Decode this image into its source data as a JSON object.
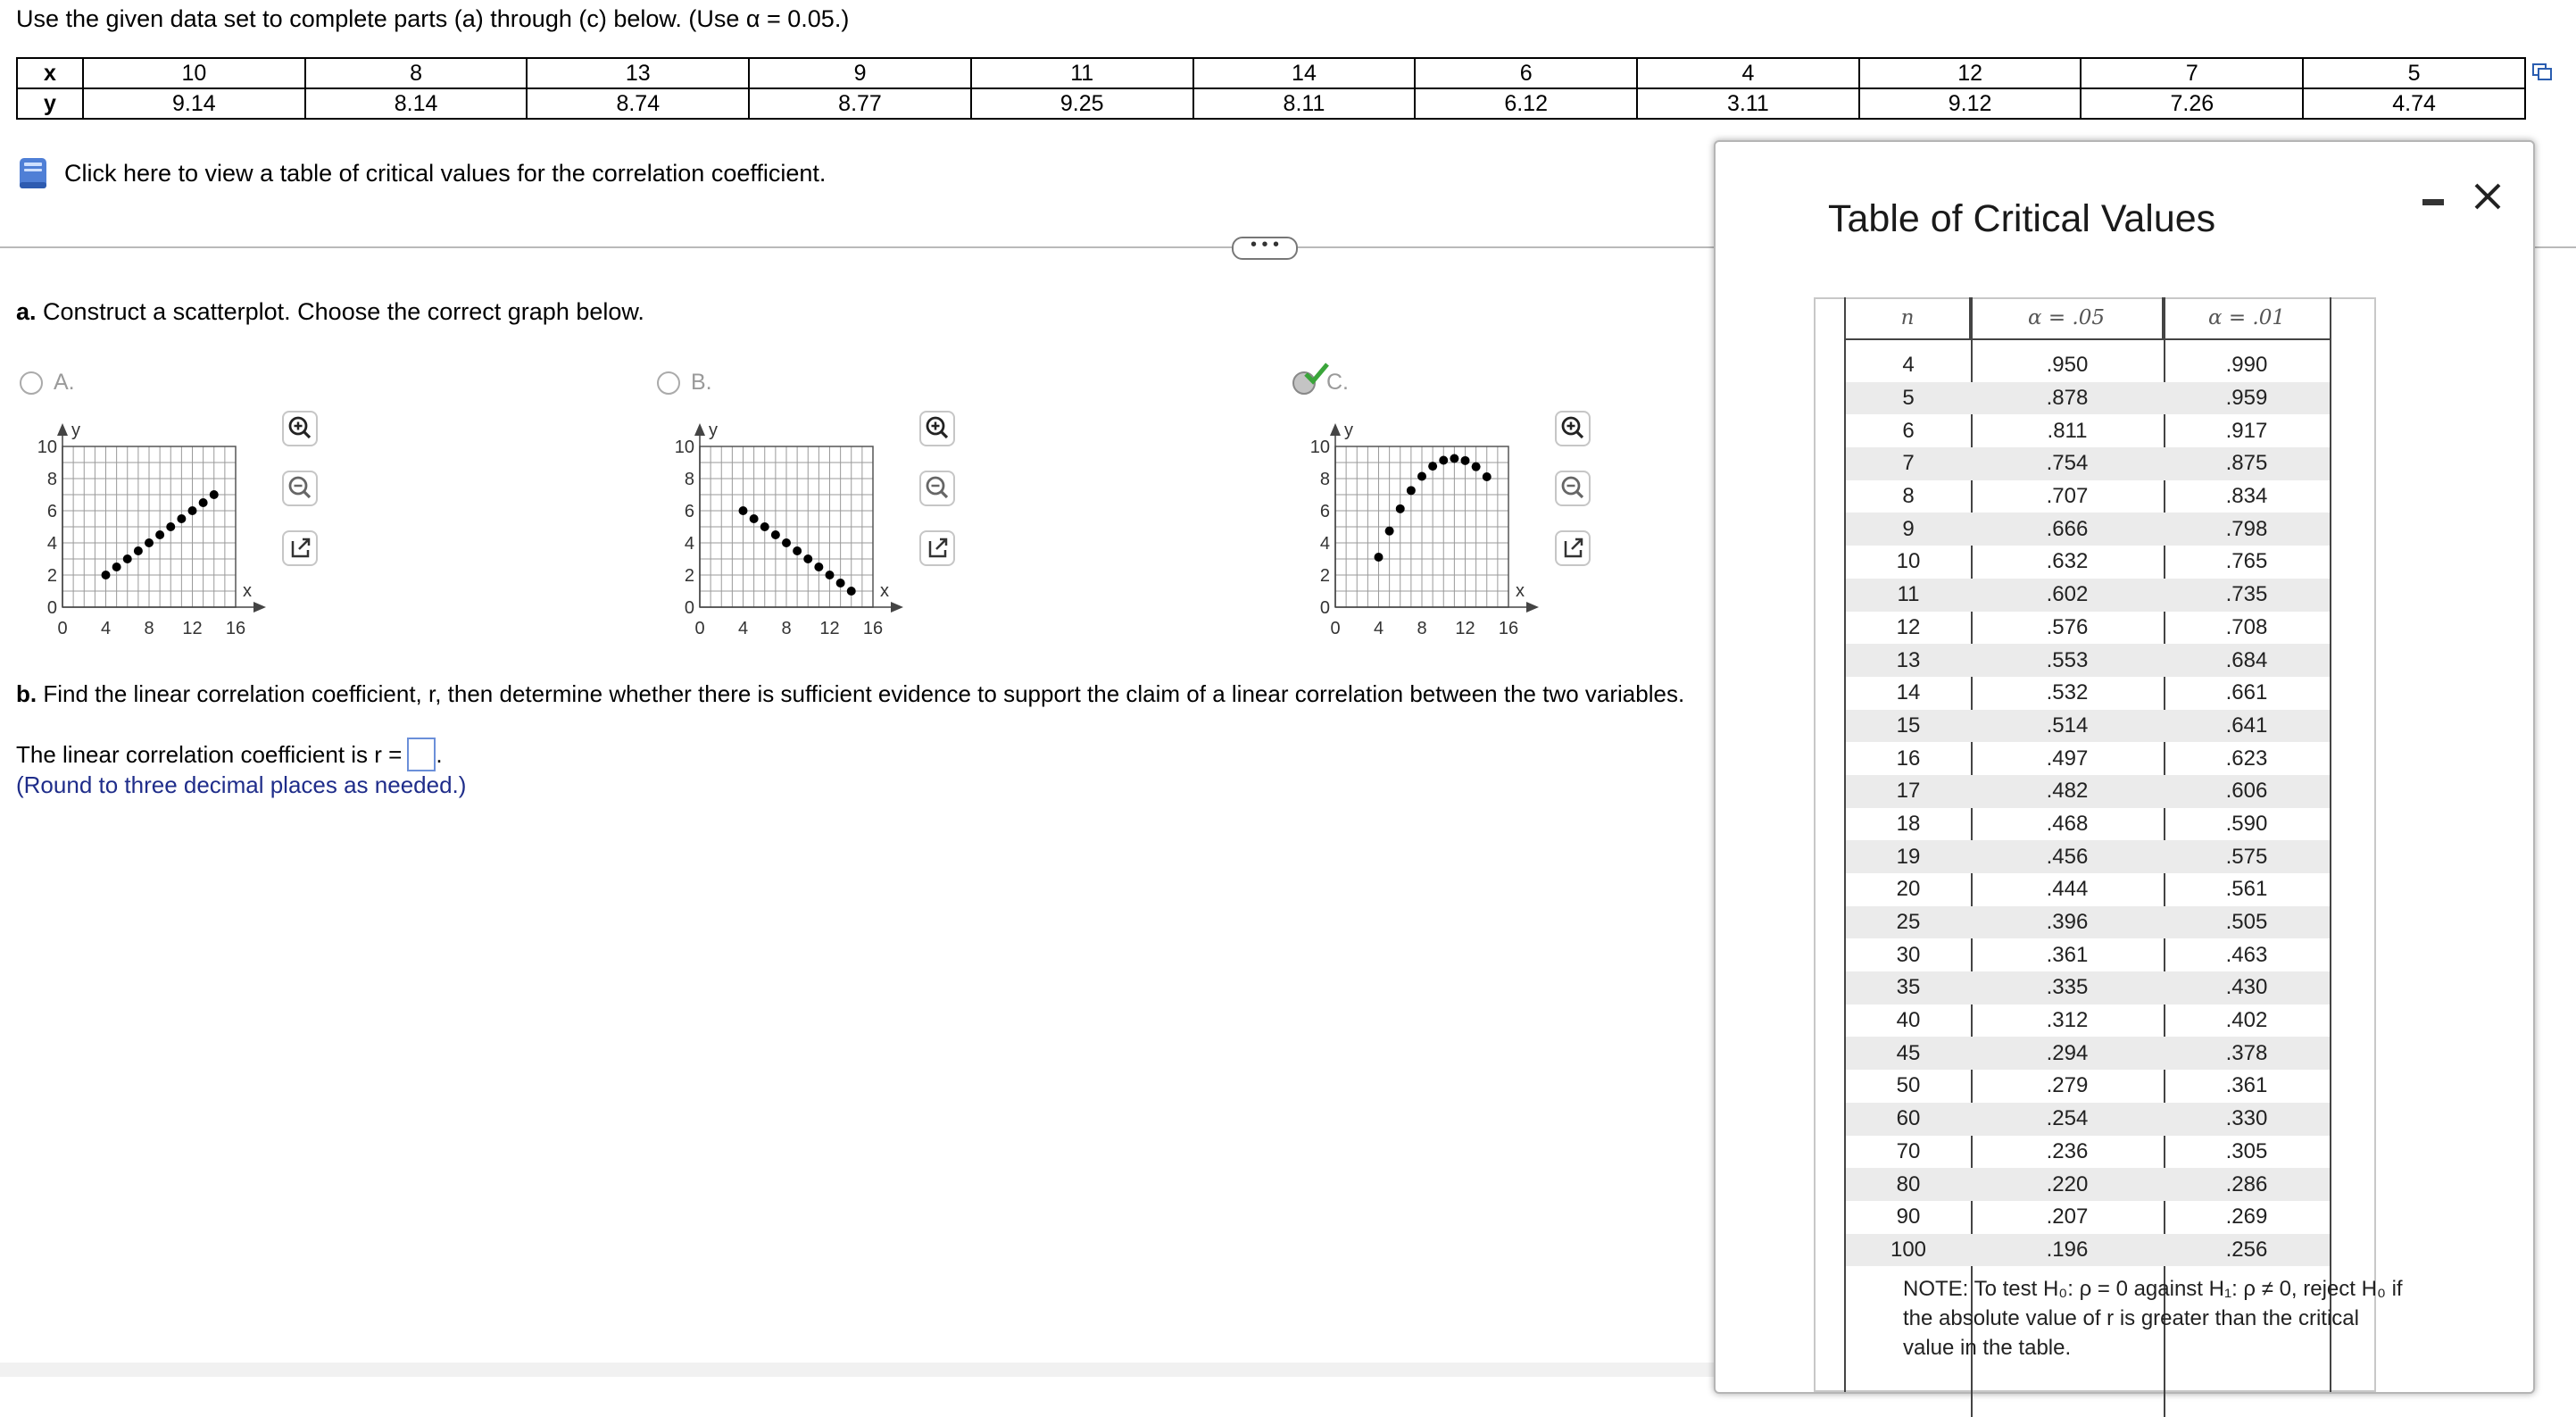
{
  "instruction": "Use the given data set to complete parts (a) through (c) below. (Use α = 0.05.)",
  "data_table": {
    "x_label": "x",
    "y_label": "y",
    "x": [
      "10",
      "8",
      "13",
      "9",
      "11",
      "14",
      "6",
      "4",
      "12",
      "7",
      "5"
    ],
    "y": [
      "9.14",
      "8.14",
      "8.74",
      "8.77",
      "9.25",
      "8.11",
      "6.12",
      "3.11",
      "9.12",
      "7.26",
      "4.74"
    ]
  },
  "critical_values_link": "Click here to view a table of critical values for the correlation coefficient.",
  "more_button": "• • •",
  "part_a": {
    "label": "a.",
    "text": "Construct a scatterplot. Choose the correct graph below.",
    "options": [
      {
        "letter": "A.",
        "selected": false,
        "points": [
          [
            4,
            2
          ],
          [
            5,
            2.5
          ],
          [
            6,
            3
          ],
          [
            7,
            3.5
          ],
          [
            8,
            4
          ],
          [
            9,
            4.5
          ],
          [
            10,
            5
          ],
          [
            11,
            5.5
          ],
          [
            12,
            6
          ],
          [
            13,
            6.5
          ],
          [
            14,
            7
          ]
        ]
      },
      {
        "letter": "B.",
        "selected": false,
        "points": [
          [
            4,
            6
          ],
          [
            5,
            5.5
          ],
          [
            6,
            5
          ],
          [
            7,
            4.5
          ],
          [
            8,
            4
          ],
          [
            9,
            3.5
          ],
          [
            10,
            3
          ],
          [
            11,
            2.5
          ],
          [
            12,
            2
          ],
          [
            13,
            1.5
          ],
          [
            14,
            1
          ]
        ]
      },
      {
        "letter": "C.",
        "selected": true,
        "points": [
          [
            4,
            3.11
          ],
          [
            5,
            4.74
          ],
          [
            6,
            6.12
          ],
          [
            7,
            7.26
          ],
          [
            8,
            8.14
          ],
          [
            9,
            8.77
          ],
          [
            10,
            9.14
          ],
          [
            11,
            9.25
          ],
          [
            12,
            9.12
          ],
          [
            13,
            8.74
          ],
          [
            14,
            8.11
          ]
        ]
      }
    ],
    "axis": {
      "y_label": "y",
      "x_label": "x",
      "y_ticks": [
        "10",
        "8",
        "6",
        "4",
        "2",
        "0"
      ],
      "x_ticks": [
        "0",
        "4",
        "8",
        "12",
        "16"
      ],
      "x_range": [
        0,
        16
      ],
      "y_range": [
        0,
        10
      ]
    }
  },
  "part_b": {
    "label": "b.",
    "text": "Find the linear correlation coefficient, r, then determine whether there is sufficient evidence to support the claim of a linear correlation between the two variables.",
    "coef_prompt": "The linear correlation coefficient is r =",
    "round_note": "(Round to three decimal places as needed.)"
  },
  "popup": {
    "title": "Table of Critical Values",
    "headers": [
      "n",
      "α = .05",
      "α = .01"
    ],
    "rows": [
      [
        "4",
        ".950",
        ".990"
      ],
      [
        "5",
        ".878",
        ".959"
      ],
      [
        "6",
        ".811",
        ".917"
      ],
      [
        "7",
        ".754",
        ".875"
      ],
      [
        "8",
        ".707",
        ".834"
      ],
      [
        "9",
        ".666",
        ".798"
      ],
      [
        "10",
        ".632",
        ".765"
      ],
      [
        "11",
        ".602",
        ".735"
      ],
      [
        "12",
        ".576",
        ".708"
      ],
      [
        "13",
        ".553",
        ".684"
      ],
      [
        "14",
        ".532",
        ".661"
      ],
      [
        "15",
        ".514",
        ".641"
      ],
      [
        "16",
        ".497",
        ".623"
      ],
      [
        "17",
        ".482",
        ".606"
      ],
      [
        "18",
        ".468",
        ".590"
      ],
      [
        "19",
        ".456",
        ".575"
      ],
      [
        "20",
        ".444",
        ".561"
      ],
      [
        "25",
        ".396",
        ".505"
      ],
      [
        "30",
        ".361",
        ".463"
      ],
      [
        "35",
        ".335",
        ".430"
      ],
      [
        "40",
        ".312",
        ".402"
      ],
      [
        "45",
        ".294",
        ".378"
      ],
      [
        "50",
        ".279",
        ".361"
      ],
      [
        "60",
        ".254",
        ".330"
      ],
      [
        "70",
        ".236",
        ".305"
      ],
      [
        "80",
        ".220",
        ".286"
      ],
      [
        "90",
        ".207",
        ".269"
      ],
      [
        "100",
        ".196",
        ".256"
      ]
    ],
    "note": "NOTE: To test H₀: ρ = 0 against H₁: ρ ≠ 0, reject H₀ if the absolute value of r is greater than the critical value in the table.",
    "minimize_label": "–",
    "close_label": "×"
  }
}
